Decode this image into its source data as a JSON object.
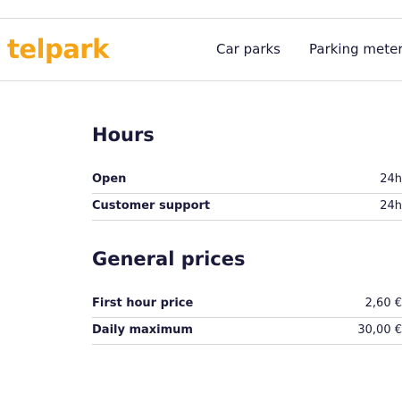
{
  "header": {
    "logo_text": "telpark",
    "nav": [
      {
        "label": "Car parks"
      },
      {
        "label": "Parking meter"
      }
    ]
  },
  "hours": {
    "title": "Hours",
    "rows": [
      {
        "label": "Open",
        "value": "24h"
      },
      {
        "label": "Customer support",
        "value": "24h"
      }
    ]
  },
  "prices": {
    "title": "General prices",
    "rows": [
      {
        "label": "First hour price",
        "value": "2,60 €"
      },
      {
        "label": "Daily maximum",
        "value": "30,00 €"
      }
    ]
  },
  "colors": {
    "brand": "#f6a417",
    "text": "#1a1a3a",
    "divider": "#d5d5d8"
  }
}
